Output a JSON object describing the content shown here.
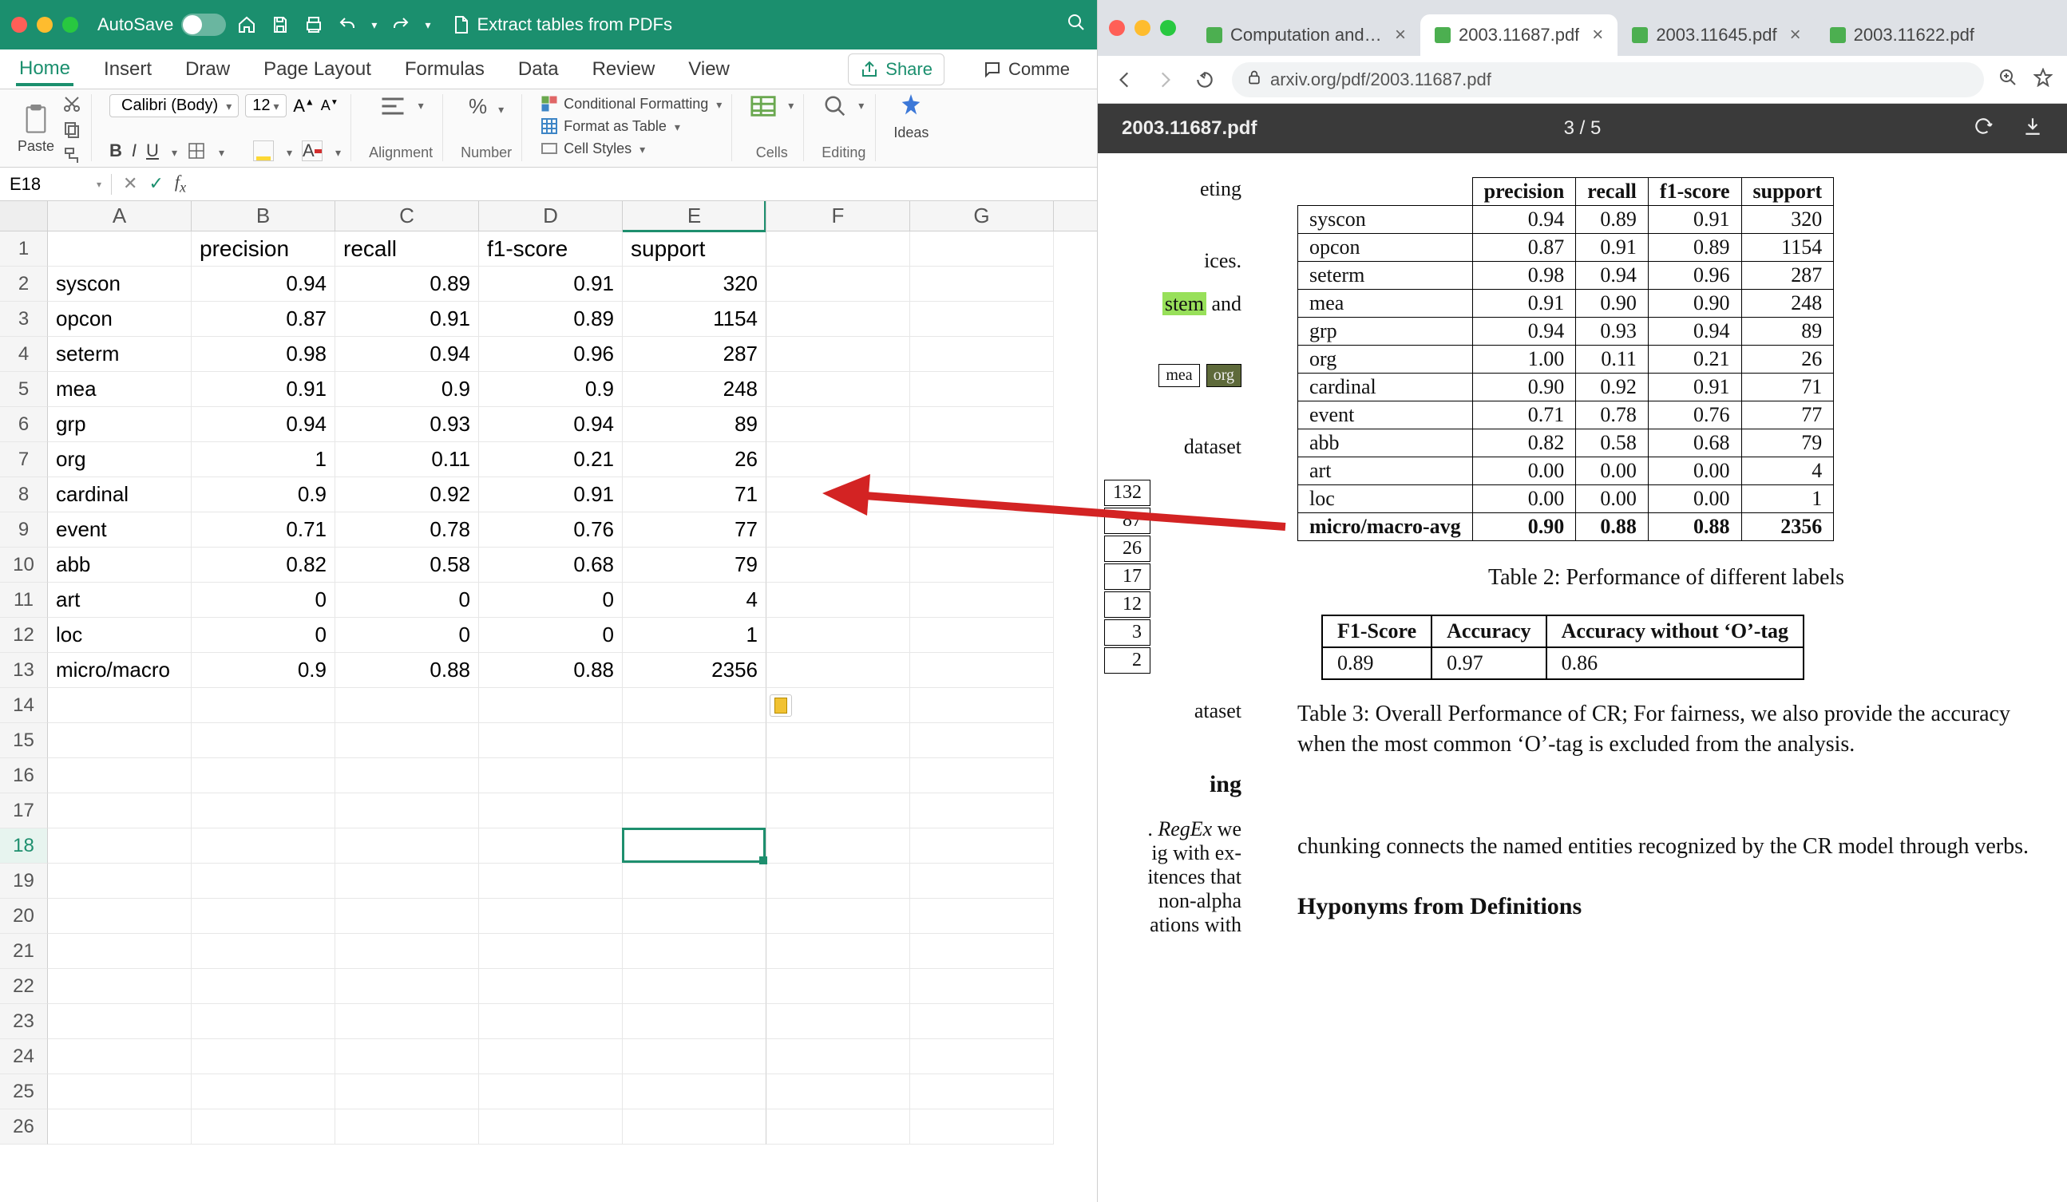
{
  "excel": {
    "title_autosave": "AutoSave",
    "title_doc_icon": "doc-icon",
    "title_doc_name": "Extract tables from PDFs",
    "menu": [
      "Home",
      "Insert",
      "Draw",
      "Page Layout",
      "Formulas",
      "Data",
      "Review",
      "View"
    ],
    "menu_share": "Share",
    "menu_comment": "Comme",
    "ribbon": {
      "paste": "Paste",
      "font_name": "Calibri (Body)",
      "font_size": "12",
      "alignment_label": "Alignment",
      "number_label": "Number",
      "cond_fmt": "Conditional Formatting",
      "as_table": "Format as Table",
      "cell_styles": "Cell Styles",
      "cells": "Cells",
      "editing": "Editing",
      "ideas": "Ideas"
    },
    "namebox": "E18",
    "columns": [
      "A",
      "B",
      "C",
      "D",
      "E",
      "F",
      "G"
    ],
    "header_row": [
      "",
      "precision",
      "recall",
      "f1-score",
      "support"
    ],
    "rows": [
      [
        "syscon",
        "0.94",
        "0.89",
        "0.91",
        "320"
      ],
      [
        "opcon",
        "0.87",
        "0.91",
        "0.89",
        "1154"
      ],
      [
        "seterm",
        "0.98",
        "0.94",
        "0.96",
        "287"
      ],
      [
        "mea",
        "0.91",
        "0.9",
        "0.9",
        "248"
      ],
      [
        "grp",
        "0.94",
        "0.93",
        "0.94",
        "89"
      ],
      [
        "org",
        "1",
        "0.11",
        "0.21",
        "26"
      ],
      [
        "cardinal",
        "0.9",
        "0.92",
        "0.91",
        "71"
      ],
      [
        "event",
        "0.71",
        "0.78",
        "0.76",
        "77"
      ],
      [
        "abb",
        "0.82",
        "0.58",
        "0.68",
        "79"
      ],
      [
        "art",
        "0",
        "0",
        "0",
        "4"
      ],
      [
        "loc",
        "0",
        "0",
        "0",
        "1"
      ],
      [
        "micro/macro",
        "0.9",
        "0.88",
        "0.88",
        "2356"
      ]
    ],
    "chart_data": {
      "type": "table",
      "columns": [
        "label",
        "precision",
        "recall",
        "f1-score",
        "support"
      ],
      "rows": [
        [
          "syscon",
          0.94,
          0.89,
          0.91,
          320
        ],
        [
          "opcon",
          0.87,
          0.91,
          0.89,
          1154
        ],
        [
          "seterm",
          0.98,
          0.94,
          0.96,
          287
        ],
        [
          "mea",
          0.91,
          0.9,
          0.9,
          248
        ],
        [
          "grp",
          0.94,
          0.93,
          0.94,
          89
        ],
        [
          "org",
          1,
          0.11,
          0.21,
          26
        ],
        [
          "cardinal",
          0.9,
          0.92,
          0.91,
          71
        ],
        [
          "event",
          0.71,
          0.78,
          0.76,
          77
        ],
        [
          "abb",
          0.82,
          0.58,
          0.68,
          79
        ],
        [
          "art",
          0,
          0,
          0,
          4
        ],
        [
          "loc",
          0,
          0,
          0,
          1
        ],
        [
          "micro/macro",
          0.9,
          0.88,
          0.88,
          2356
        ]
      ]
    },
    "active_cell": "E18"
  },
  "chrome": {
    "tabs": [
      {
        "title": "Computation and Lan",
        "favicon": "#4caf50"
      },
      {
        "title": "2003.11687.pdf",
        "favicon": "#4caf50",
        "active": true
      },
      {
        "title": "2003.11645.pdf",
        "favicon": "#4caf50"
      },
      {
        "title": "2003.11622.pdf",
        "favicon": "#4caf50"
      }
    ],
    "url": "arxiv.org/pdf/2003.11687.pdf",
    "pdf_toolbar_title": "2003.11687.pdf",
    "pdf_page": "3 / 5"
  },
  "pdf_left": {
    "bit1": "eting",
    "bit2": "ices.",
    "bit3_left": "stem",
    "bit3_right": " and",
    "tag1": "mea",
    "tag2": "org",
    "dataset1": "dataset",
    "mini_table": [
      "132",
      "87",
      "26",
      "17",
      "12",
      "3",
      "2"
    ],
    "dataset2": "ataset",
    "heading_frag": "ing",
    "para_bits": [
      ". RegEx we",
      "ig with ex-",
      "itences that",
      " non-alpha",
      "ations  with"
    ]
  },
  "pdf_right": {
    "table2_headers": [
      "",
      "precision",
      "recall",
      "f1-score",
      "support"
    ],
    "table2": [
      [
        "syscon",
        "0.94",
        "0.89",
        "0.91",
        "320"
      ],
      [
        "opcon",
        "0.87",
        "0.91",
        "0.89",
        "1154"
      ],
      [
        "seterm",
        "0.98",
        "0.94",
        "0.96",
        "287"
      ],
      [
        "mea",
        "0.91",
        "0.90",
        "0.90",
        "248"
      ],
      [
        "grp",
        "0.94",
        "0.93",
        "0.94",
        "89"
      ],
      [
        "org",
        "1.00",
        "0.11",
        "0.21",
        "26"
      ],
      [
        "cardinal",
        "0.90",
        "0.92",
        "0.91",
        "71"
      ],
      [
        "event",
        "0.71",
        "0.78",
        "0.76",
        "77"
      ],
      [
        "abb",
        "0.82",
        "0.58",
        "0.68",
        "79"
      ],
      [
        "art",
        "0.00",
        "0.00",
        "0.00",
        "4"
      ],
      [
        "loc",
        "0.00",
        "0.00",
        "0.00",
        "1"
      ],
      [
        "micro/macro-avg",
        "0.90",
        "0.88",
        "0.88",
        "2356"
      ]
    ],
    "caption2": "Table 2: Performance of different labels",
    "table3_headers": [
      "F1-Score",
      "Accuracy",
      "Accuracy without ‘O’-tag"
    ],
    "table3_row": [
      "0.89",
      "0.97",
      "0.86"
    ],
    "caption3": "Table 3: Overall Performance of CR; For fairness, we also provide the accuracy when the most common ‘O’-tag is excluded from the analysis.",
    "para1": "chunking connects the named entities recognized by the CR model through verbs.",
    "heading": "Hyponyms from Definitions"
  }
}
